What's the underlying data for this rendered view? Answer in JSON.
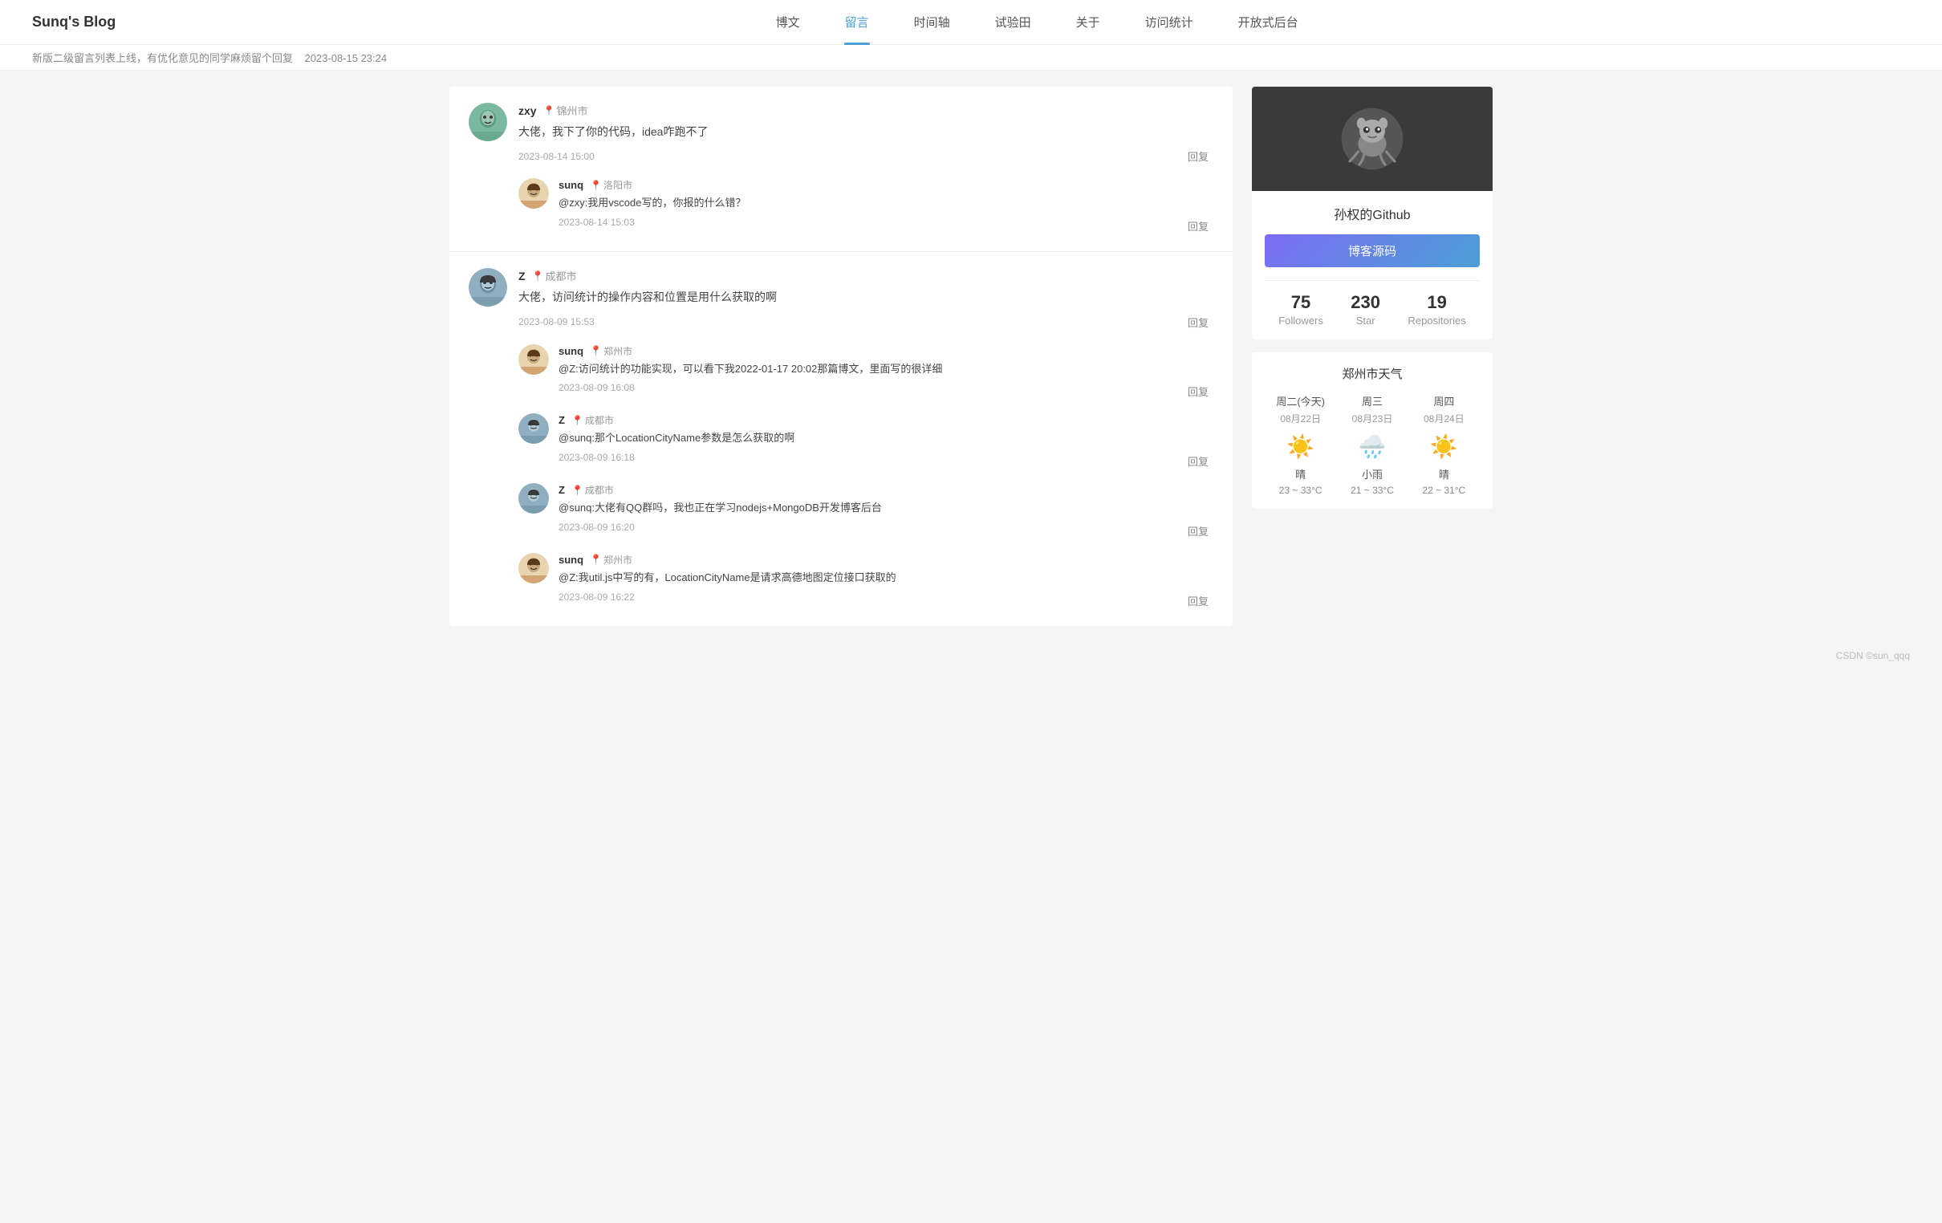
{
  "site": {
    "title": "Sunq's Blog",
    "footer_credit": "CSDN ©sun_qqq"
  },
  "nav": {
    "items": [
      {
        "id": "blog",
        "label": "博文"
      },
      {
        "id": "messages",
        "label": "留言",
        "active": true
      },
      {
        "id": "timeline",
        "label": "时间轴"
      },
      {
        "id": "lab",
        "label": "试验田"
      },
      {
        "id": "about",
        "label": "关于"
      },
      {
        "id": "stats",
        "label": "访问统计"
      },
      {
        "id": "admin",
        "label": "开放式后台"
      }
    ]
  },
  "announcement": {
    "text": "新版二级留言列表上线，有优化意见的同学麻烦留个回复",
    "date": "2023-08-15 23:24"
  },
  "comments": [
    {
      "id": 1,
      "author": "zxy",
      "location": "锦州市",
      "text": "大佬，我下了你的代码，idea咋跑不了",
      "time": "2023-08-14 15:00",
      "reply_label": "回复",
      "replies": [
        {
          "id": 11,
          "author": "sunq",
          "location": "洛阳市",
          "text": "@zxy:我用vscode写的，你报的什么错？",
          "time": "2023-08-14 15:03",
          "reply_label": "回复"
        }
      ]
    },
    {
      "id": 2,
      "author": "Z",
      "location": "成都市",
      "text": "大佬，访问统计的操作内容和位置是用什么获取的啊",
      "time": "2023-08-09 15:53",
      "reply_label": "回复",
      "replies": [
        {
          "id": 21,
          "author": "sunq",
          "location": "郑州市",
          "text": "@Z:访问统计的功能实现，可以看下我2022-01-17 20:02那篇博文，里面写的很详细",
          "time": "2023-08-09 16:08",
          "reply_label": "回复"
        },
        {
          "id": 22,
          "author": "Z",
          "location": "成都市",
          "text": "@sunq:那个LocationCityName参数是怎么获取的啊",
          "time": "2023-08-09 16:18",
          "reply_label": "回复"
        },
        {
          "id": 23,
          "author": "Z",
          "location": "成都市",
          "text": "@sunq:大佬有QQ群吗，我也正在学习nodejs+MongoDB开发博客后台",
          "time": "2023-08-09 16:20",
          "reply_label": "回复"
        },
        {
          "id": 24,
          "author": "sunq",
          "location": "郑州市",
          "text": "@Z:我util.js中写的有，LocationCityName是请求高德地图定位接口获取的",
          "time": "2023-08-09 16:22",
          "reply_label": "回复"
        }
      ]
    }
  ],
  "github": {
    "title": "孙权的Github",
    "button_label": "博客源码",
    "stats": {
      "followers": {
        "value": "75",
        "label": "Followers"
      },
      "star": {
        "value": "230",
        "label": "Star"
      },
      "repositories": {
        "value": "19",
        "label": "Repositories"
      }
    }
  },
  "weather": {
    "title": "郑州市天气",
    "days": [
      {
        "name": "周二(今天)",
        "date": "08月22日",
        "icon": "☀️",
        "desc": "晴",
        "temp": "23 ~ 33°C"
      },
      {
        "name": "周三",
        "date": "08月23日",
        "icon": "🌧️",
        "desc": "小雨",
        "temp": "21 ~ 33°C"
      },
      {
        "name": "周四",
        "date": "08月24日",
        "icon": "☀️",
        "desc": "晴",
        "temp": "22 ~ 31°C"
      }
    ]
  },
  "avatars": {
    "zxy_color": "#7ab8a0",
    "sunq_color": "#e8d5b0",
    "z_color": "#8faec0"
  }
}
